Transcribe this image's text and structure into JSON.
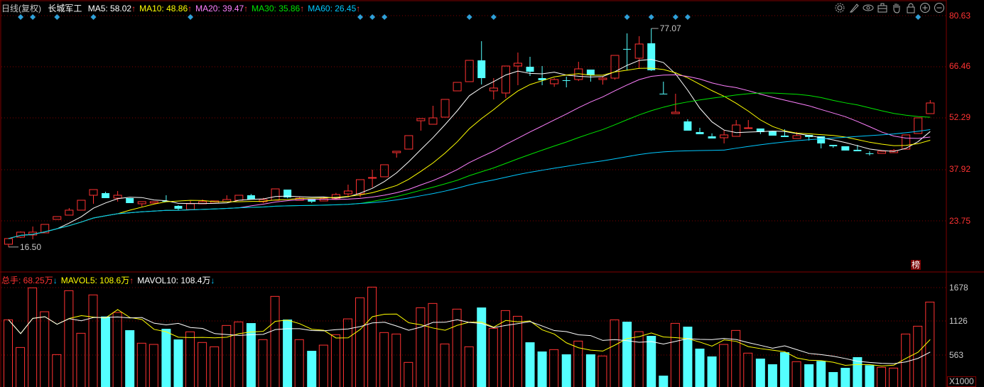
{
  "header": {
    "period": "日线(复权)",
    "stock_name": "长城军工",
    "ma_labels": [
      {
        "label": "MA5: 58.02",
        "arrow": "↑",
        "color": "#ffffff",
        "arrow_color": "#ff3232"
      },
      {
        "label": "MA10: 48.86",
        "arrow": "↑",
        "color": "#ffff00",
        "arrow_color": "#ff3232"
      },
      {
        "label": "MA20: 39.47",
        "arrow": "↑",
        "color": "#ff80ff",
        "arrow_color": "#ff3232"
      },
      {
        "label": "MA30: 35.86",
        "arrow": "↑",
        "color": "#00e600",
        "arrow_color": "#ff3232"
      },
      {
        "label": "MA60: 26.45",
        "arrow": "↑",
        "color": "#00c8ff",
        "arrow_color": "#ff3232"
      }
    ]
  },
  "volume_header": [
    {
      "label": "总手: 68.25万",
      "arrow": "↓",
      "color": "#ff3232",
      "arrow_color": "#00c8ff"
    },
    {
      "label": "MAVOL5: 108.6万",
      "arrow": "↑",
      "color": "#ffff00",
      "arrow_color": "#ff3232"
    },
    {
      "label": "MAVOL10: 108.4万",
      "arrow": "↓",
      "color": "#ffffff",
      "arrow_color": "#00c8ff"
    }
  ],
  "toolbar": [
    "gear-icon",
    "brush-icon",
    "eye-icon",
    "briefcase-icon",
    "hand-icon",
    "lock-icon",
    "zoom-in-icon",
    "zoom-out-icon"
  ],
  "badge": "榜",
  "colors": {
    "up": "#ff3232",
    "down": "#54ffff",
    "grid": "#800000",
    "marker": "#2fa0d8",
    "ma5": "#ffffff",
    "ma10": "#ffff00",
    "ma20": "#ff80ff",
    "ma30": "#00e600",
    "ma60": "#00c8ff",
    "mavol5": "#ffff00",
    "mavol10": "#ffffff"
  },
  "chart_data": {
    "type": "candlestick",
    "price_axis": {
      "ticks": [
        "80.63",
        "66.46",
        "52.29",
        "37.92",
        "23.75"
      ],
      "range": [
        16.0,
        80.63
      ]
    },
    "volume_axis": {
      "ticks": [
        "1678",
        "1126",
        "563"
      ],
      "unit": "X1000",
      "range": [
        0,
        1678
      ]
    },
    "annotations": {
      "high": "77.07",
      "low": "16.50"
    },
    "ohlc": [
      [
        17.26,
        18.84,
        16.5,
        18.84
      ],
      [
        19.23,
        20.8,
        19.0,
        20.61
      ],
      [
        19.82,
        22.18,
        18.64,
        20.61
      ],
      [
        20.41,
        22.77,
        20.41,
        22.77
      ],
      [
        24.15,
        24.93,
        24.15,
        24.93
      ],
      [
        25.33,
        27.3,
        25.33,
        26.71
      ],
      [
        26.71,
        29.46,
        26.71,
        29.46
      ],
      [
        30.84,
        32.41,
        28.48,
        32.41
      ],
      [
        31.43,
        31.82,
        30.05,
        30.05
      ],
      [
        30.05,
        32.02,
        29.07,
        30.84
      ],
      [
        30.05,
        30.05,
        28.67,
        28.67
      ],
      [
        28.48,
        29.07,
        27.69,
        29.07
      ],
      [
        28.67,
        29.07,
        28.67,
        29.07
      ],
      [
        29.27,
        30.84,
        29.07,
        29.07
      ],
      [
        27.89,
        28.08,
        26.71,
        27.1
      ],
      [
        26.9,
        29.27,
        26.9,
        28.48
      ],
      [
        28.48,
        29.66,
        28.48,
        29.07
      ],
      [
        28.67,
        29.27,
        28.67,
        29.27
      ],
      [
        29.07,
        30.84,
        29.07,
        29.66
      ],
      [
        29.46,
        30.84,
        29.46,
        30.84
      ],
      [
        30.84,
        31.2,
        29.66,
        29.66
      ],
      [
        29.07,
        30.1,
        28.7,
        29.66
      ],
      [
        29.46,
        32.61,
        29.46,
        32.61
      ],
      [
        32.41,
        32.41,
        30.0,
        30.25
      ],
      [
        29.46,
        30.5,
        29.46,
        30.05
      ],
      [
        29.86,
        29.86,
        28.7,
        29.07
      ],
      [
        29.27,
        30.4,
        29.27,
        29.86
      ],
      [
        29.86,
        31.5,
        29.86,
        31.04
      ],
      [
        31.23,
        33.79,
        30.6,
        32.02
      ],
      [
        31.23,
        35.17,
        30.3,
        35.17
      ],
      [
        35.56,
        37.92,
        33.0,
        35.76
      ],
      [
        35.96,
        39.3,
        35.96,
        39.3
      ],
      [
        42.65,
        43.04,
        41.27,
        43.04
      ],
      [
        43.63,
        47.37,
        43.63,
        47.37
      ],
      [
        51.5,
        52.09,
        48.75,
        52.09
      ],
      [
        50.52,
        55.64,
        50.52,
        52.29
      ],
      [
        52.49,
        57.41,
        52.49,
        57.41
      ],
      [
        59.77,
        62.13,
        59.77,
        62.13
      ],
      [
        62.33,
        68.23,
        62.33,
        68.23
      ],
      [
        68.23,
        73.55,
        61.54,
        63.31
      ],
      [
        59.77,
        63.31,
        57.41,
        60.56
      ],
      [
        59.18,
        66.66,
        57.8,
        66.66
      ],
      [
        66.66,
        70.4,
        61.34,
        67.44
      ],
      [
        66.46,
        69.22,
        63.9,
        65.08
      ],
      [
        63.31,
        66.66,
        61.34,
        62.72
      ],
      [
        61.74,
        63.3,
        60.9,
        62.92
      ],
      [
        62.72,
        63.71,
        60.75,
        62.6
      ],
      [
        62.92,
        67.84,
        62.5,
        65.87
      ],
      [
        65.67,
        65.67,
        62.33,
        64.1
      ],
      [
        62.92,
        63.7,
        61.5,
        63.31
      ],
      [
        63.31,
        69.61,
        62.9,
        69.61
      ],
      [
        71.4,
        75.71,
        65.48,
        71.3
      ],
      [
        68.82,
        74.92,
        65.87,
        72.76
      ],
      [
        72.96,
        77.07,
        65.3,
        65.48
      ],
      [
        59.0,
        62.33,
        58.98,
        58.98
      ],
      [
        53.47,
        58.98,
        53.47,
        53.87
      ],
      [
        51.31,
        51.9,
        48.75,
        48.75
      ],
      [
        48.36,
        49.54,
        47.76,
        47.76
      ],
      [
        47.17,
        48.0,
        46.58,
        46.58
      ],
      [
        46.78,
        48.95,
        45.21,
        47.57
      ],
      [
        47.17,
        51.7,
        47.17,
        50.32
      ],
      [
        49.34,
        51.7,
        49.34,
        49.54
      ],
      [
        49.34,
        49.34,
        47.8,
        48.36
      ],
      [
        48.55,
        48.55,
        47.37,
        47.37
      ],
      [
        47.37,
        49.14,
        46.98,
        46.98
      ],
      [
        46.58,
        48.36,
        46.58,
        47.37
      ],
      [
        47.57,
        47.57,
        46.0,
        46.98
      ],
      [
        47.17,
        47.17,
        43.83,
        45.21
      ],
      [
        44.81,
        44.81,
        44.0,
        44.42
      ],
      [
        44.42,
        44.42,
        43.24,
        43.24
      ],
      [
        43.44,
        44.81,
        43.04,
        43.04
      ],
      [
        42.45,
        43.04,
        41.86,
        42.4
      ],
      [
        42.45,
        43.04,
        42.45,
        43.04
      ],
      [
        42.65,
        43.63,
        42.65,
        43.24
      ],
      [
        43.63,
        47.57,
        43.63,
        47.57
      ],
      [
        47.96,
        52.29,
        47.96,
        52.29
      ],
      [
        53.47,
        57.21,
        53.47,
        56.42
      ]
    ],
    "volume": [
      1146,
      688,
      1674,
      1279,
      571,
      1627,
      923,
      1557,
      1200,
      1267,
      974,
      759,
      739,
      997,
      821,
      947,
      771,
      700,
      1052,
      1111,
      1091,
      818,
      1533,
      1150,
      818,
      633,
      727,
      900,
      1161,
      1510,
      1686,
      935,
      911,
      442,
      1345,
      1416,
      747,
      1322,
      700,
      1349,
      1005,
      1298,
      1204,
      774,
      622,
      653,
      575,
      794,
      575,
      548,
      1146,
      1114,
      950,
      880,
      223,
      1087,
      1032,
      669,
      540,
      739,
      970,
      595,
      504,
      411,
      610,
      454,
      411,
      465,
      282,
      352,
      528,
      395,
      360,
      348,
      911,
      1040,
      1439
    ],
    "markers": [
      2,
      3,
      5,
      8,
      16,
      30,
      31,
      32,
      39,
      41,
      52,
      54,
      56,
      57,
      76
    ],
    "moving_averages": [
      "MA5",
      "MA10",
      "MA20",
      "MA30",
      "MA60"
    ],
    "volume_moving_averages": [
      "MAVOL5",
      "MAVOL10"
    ]
  }
}
